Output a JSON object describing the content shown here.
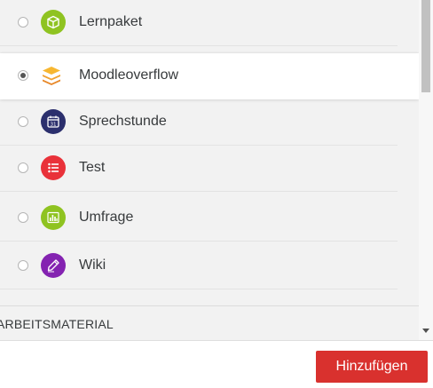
{
  "activities": [
    {
      "label": "Lernpaket",
      "icon": "package-icon",
      "color": "#8fc321",
      "selected": false
    },
    {
      "label": "Moodleoverflow",
      "icon": "stack-icon",
      "color": "#f0a232",
      "selected": true
    },
    {
      "label": "Sprechstunde",
      "icon": "calendar-icon",
      "color": "#2b2f6d",
      "selected": false
    },
    {
      "label": "Test",
      "icon": "checklist-icon",
      "color": "#e9323a",
      "selected": false
    },
    {
      "label": "Umfrage",
      "icon": "bar-chart-icon",
      "color": "#8fc321",
      "selected": false
    },
    {
      "label": "Wiki",
      "icon": "pencil-icon",
      "color": "#8423b1",
      "selected": false
    }
  ],
  "section": {
    "label": "ARBEITSMATERIAL"
  },
  "footer": {
    "add_label": "Hinzufügen",
    "add_color": "#d9312e"
  }
}
